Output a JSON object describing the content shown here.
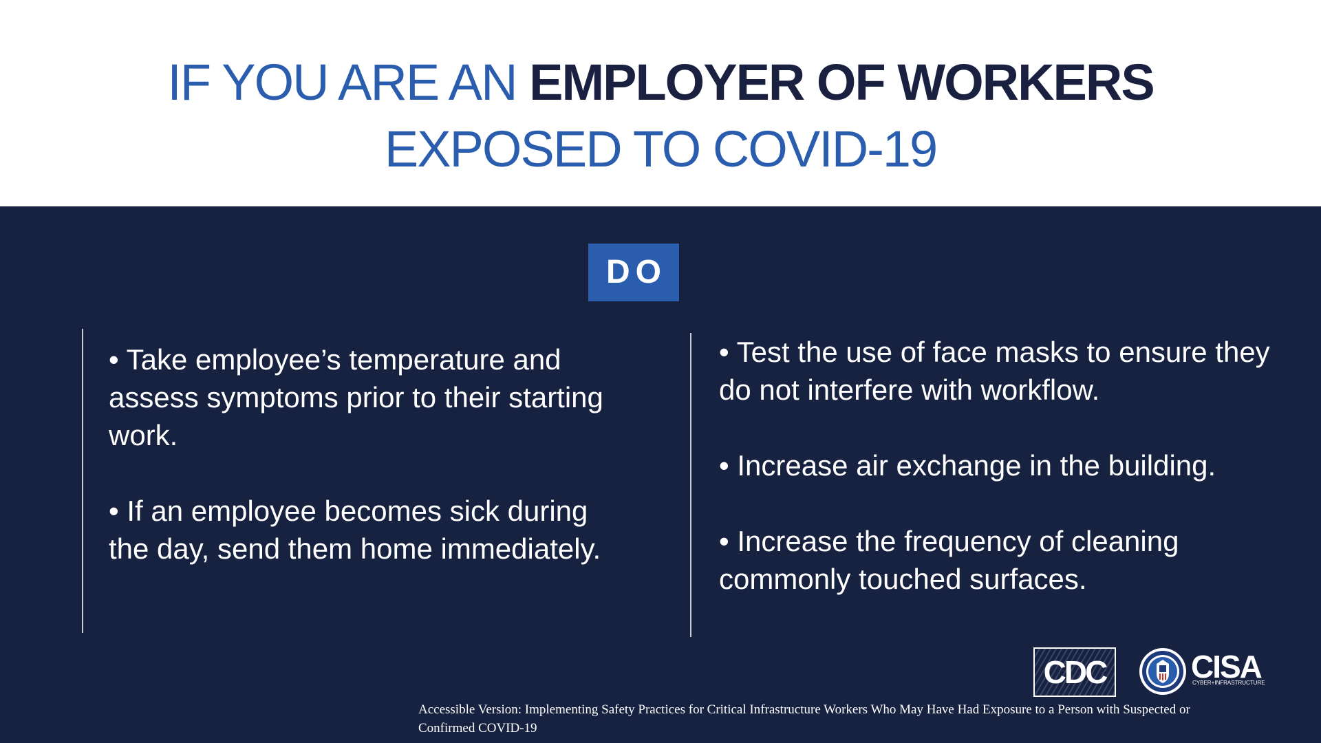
{
  "header": {
    "title_line1_light": "IF YOU ARE AN ",
    "title_line1_bold": "EMPLOYER OF WORKERS",
    "title_line2": "EXPOSED TO COVID-19"
  },
  "badge": {
    "label": "DO"
  },
  "left_column": {
    "bullets": [
      "• Take employee’s temperature and assess symptoms prior to their starting work.",
      "• If an employee becomes sick during the day, send them home immediately."
    ]
  },
  "right_column": {
    "bullets": [
      "• Test the use of face masks to ensure they do not interfere with workflow.",
      "• Increase air exchange in the building.",
      "• Increase the frequency of cleaning commonly touched surfaces."
    ]
  },
  "logos": {
    "cdc_text": "CDC",
    "cisa_text": "CISA",
    "cisa_subtitle": "CYBER+INFRASTRUCTURE",
    "seal_icon": "dhs-seal-icon"
  },
  "footer": {
    "note": "Accessible Version: Implementing Safety Practices for Critical Infrastructure Workers Who May Have Had Exposure to a Person with Suspected or Confirmed COVID-19"
  },
  "colors": {
    "title_blue": "#2a5dae",
    "title_dark": "#1a2040",
    "panel_navy": "#172140",
    "badge_blue": "#2a5dae",
    "text_white": "#ffffff"
  }
}
